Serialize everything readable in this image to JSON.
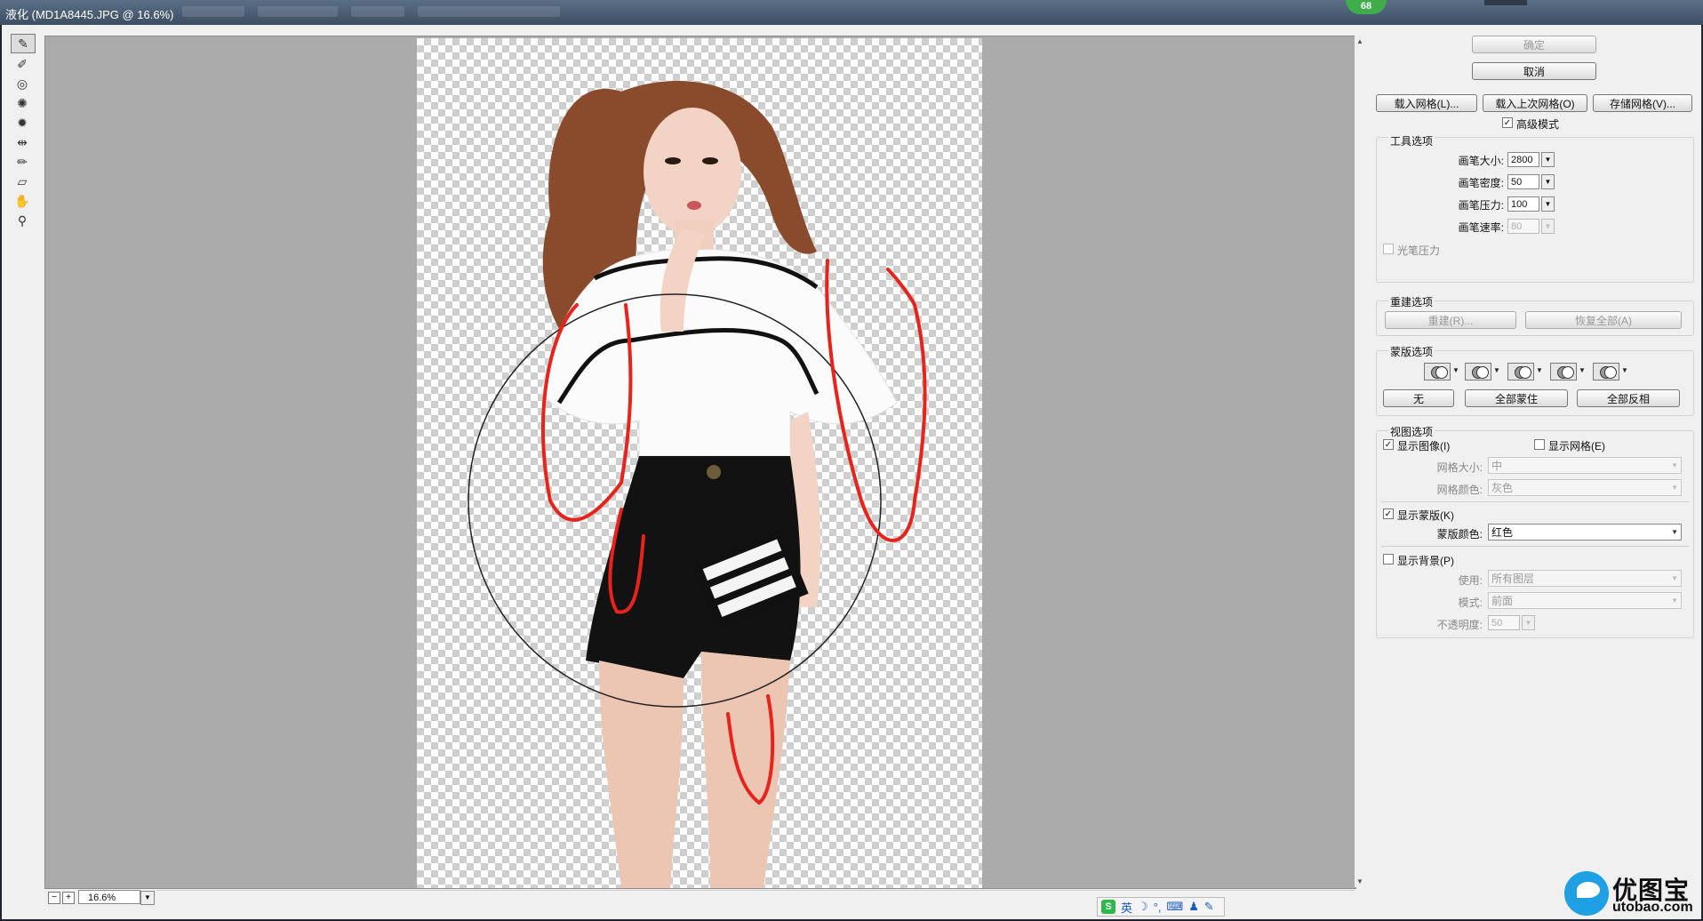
{
  "window": {
    "title": "液化 (MD1A8445.JPG @ 16.6%)",
    "badge": "68"
  },
  "tools": [
    "forward-warp",
    "reconstruct",
    "twirl",
    "pucker",
    "bloat",
    "push-left",
    "freeze-mask",
    "thaw-mask",
    "hand",
    "zoom"
  ],
  "statusbar": {
    "zoom_value": "16.6%"
  },
  "ime": {
    "lang": "英"
  },
  "watermark": {
    "name": "优图宝",
    "url": "utobao.com"
  },
  "panel": {
    "ok_label": "确定",
    "cancel_label": "取消",
    "load_mesh_label": "载入网格(L)...",
    "load_last_mesh_label": "载入上次网格(O)",
    "save_mesh_label": "存储网格(V)...",
    "advanced_mode_label": "高级模式",
    "tool_options": {
      "title": "工具选项",
      "brush_size_label": "画笔大小:",
      "brush_size": "2800",
      "brush_density_label": "画笔密度:",
      "brush_density": "50",
      "brush_pressure_label": "画笔压力:",
      "brush_pressure": "100",
      "brush_rate_label": "画笔速率:",
      "brush_rate": "80",
      "stylus_pressure_label": "光笔压力"
    },
    "reconstruct_options": {
      "title": "重建选项",
      "reconstruct_label": "重建(R)...",
      "restore_all_label": "恢复全部(A)"
    },
    "mask_options": {
      "title": "蒙版选项",
      "none_label": "无",
      "mask_all_label": "全部蒙住",
      "invert_all_label": "全部反相"
    },
    "view_options": {
      "title": "视图选项",
      "show_image_label": "显示图像(I)",
      "show_mesh_label": "显示网格(E)",
      "mesh_size_label": "网格大小:",
      "mesh_size": "中",
      "mesh_color_label": "网格颜色:",
      "mesh_color": "灰色",
      "show_mask_label": "显示蒙版(K)",
      "mask_color_label": "蒙版颜色:",
      "mask_color": "红色",
      "show_backdrop_label": "显示背景(P)",
      "use_label": "使用:",
      "use_value": "所有图层",
      "mode_label": "模式:",
      "mode_value": "前面",
      "opacity_label": "不透明度:",
      "opacity_value": "50"
    }
  },
  "colors": {
    "mask_red": "#e8231b",
    "panel_bg": "#f0f0f0",
    "canvas_bg": "#ababab"
  }
}
